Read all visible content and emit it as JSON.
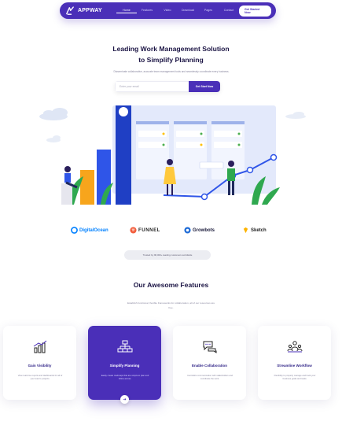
{
  "nav": {
    "logo_text": "APPWAY",
    "items": [
      {
        "label": "Home",
        "active": true
      },
      {
        "label": "Features",
        "active": false
      },
      {
        "label": "Video",
        "active": false
      },
      {
        "label": "Download",
        "active": false
      },
      {
        "label": "Pages",
        "active": false
      },
      {
        "label": "Contact",
        "active": false
      }
    ],
    "cta_label": "Get Started Now"
  },
  "hero": {
    "title_line1": "Leading Work Management Solution",
    "title_line2": "to Simplify Planning",
    "subtitle": "Disseminate collaborative, accurate team management tools and seamlessly coordinate every business.",
    "input_placeholder": "Enter your email",
    "button_label": "Get Start Now"
  },
  "partners": [
    {
      "name": "DigitalOcean",
      "icon": "digitalocean-icon"
    },
    {
      "name": "FUNNEL",
      "icon": "funnel-icon"
    },
    {
      "name": "Growbots",
      "icon": "growbots-icon"
    },
    {
      "name": "Sketch",
      "icon": "sketch-icon"
    }
  ],
  "trust_text": "Trusted by 96,000+ leading customers worldwide",
  "features": {
    "title": "Our Awesome Features",
    "subtitle": "Establish functional, flexible frameworks for collaboration, all of our resources are free.",
    "cards": [
      {
        "title": "Gain Visibility",
        "desc": "View real-time reports and dashboards for all of your team's projects.",
        "icon": "chart-icon",
        "active": false
      },
      {
        "title": "Simplify Planning",
        "desc": "Easily create roadmaps that are simple to plan and follow across.",
        "icon": "hierarchy-icon",
        "active": true
      },
      {
        "title": "Enable Collaboration",
        "desc": "Centralize communication with stakeholders and coordinate the work.",
        "icon": "chat-icon",
        "active": false
      },
      {
        "title": "Streamline Workflow",
        "desc": "Flexibility to properly manage and track your business goals and tasks.",
        "icon": "team-icon",
        "active": false
      }
    ]
  },
  "colors": {
    "brand": "#4a2fb8",
    "heading": "#1b1444",
    "muted": "#8a88a0"
  }
}
